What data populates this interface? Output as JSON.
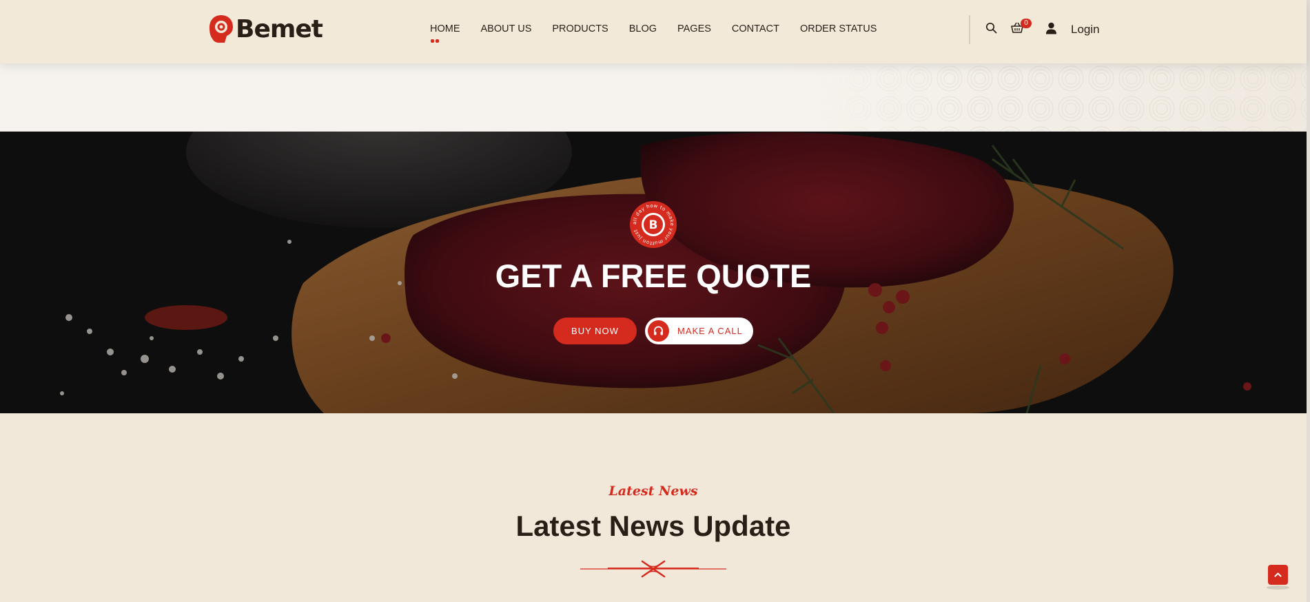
{
  "brand": {
    "name": "Bemet",
    "accent": "#d52a1e",
    "dark": "#2a1f17",
    "cream": "#f1e8d9"
  },
  "nav": {
    "items": [
      {
        "label": "HOME",
        "active": true
      },
      {
        "label": "ABOUT US"
      },
      {
        "label": "PRODUCTS"
      },
      {
        "label": "BLOG"
      },
      {
        "label": "PAGES"
      },
      {
        "label": "CONTACT"
      },
      {
        "label": "ORDER STATUS"
      }
    ]
  },
  "header": {
    "icons": [
      "search-icon",
      "cart-icon",
      "user-icon"
    ],
    "cart_count": "0",
    "login_label": "Login"
  },
  "hero": {
    "stamp_letter": "B",
    "stamp_ring_text": "all day how to make your mutton just",
    "title": "GET A FREE QUOTE",
    "buy_label": "BUY NOW",
    "call_label": "MAKE A CALL",
    "call_icon": "headphones-icon"
  },
  "news": {
    "subtitle": "Latest News",
    "title": "Latest News Update",
    "decor_icon": "bow-divider-icon"
  },
  "scroll_top_icon": "chevron-up-icon"
}
